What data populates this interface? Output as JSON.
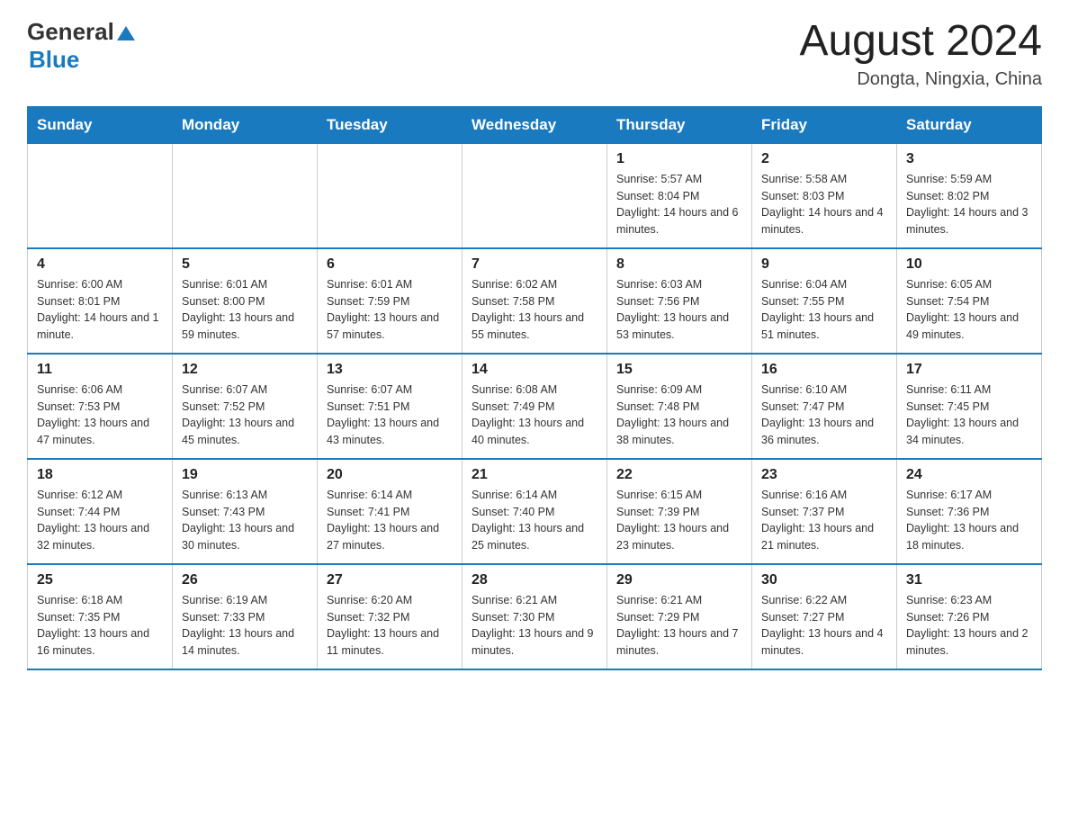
{
  "header": {
    "logo_general": "General",
    "logo_blue": "Blue",
    "title": "August 2024",
    "subtitle": "Dongta, Ningxia, China"
  },
  "weekdays": [
    "Sunday",
    "Monday",
    "Tuesday",
    "Wednesday",
    "Thursday",
    "Friday",
    "Saturday"
  ],
  "weeks": [
    [
      {
        "day": "",
        "info": ""
      },
      {
        "day": "",
        "info": ""
      },
      {
        "day": "",
        "info": ""
      },
      {
        "day": "",
        "info": ""
      },
      {
        "day": "1",
        "info": "Sunrise: 5:57 AM\nSunset: 8:04 PM\nDaylight: 14 hours and 6 minutes."
      },
      {
        "day": "2",
        "info": "Sunrise: 5:58 AM\nSunset: 8:03 PM\nDaylight: 14 hours and 4 minutes."
      },
      {
        "day": "3",
        "info": "Sunrise: 5:59 AM\nSunset: 8:02 PM\nDaylight: 14 hours and 3 minutes."
      }
    ],
    [
      {
        "day": "4",
        "info": "Sunrise: 6:00 AM\nSunset: 8:01 PM\nDaylight: 14 hours and 1 minute."
      },
      {
        "day": "5",
        "info": "Sunrise: 6:01 AM\nSunset: 8:00 PM\nDaylight: 13 hours and 59 minutes."
      },
      {
        "day": "6",
        "info": "Sunrise: 6:01 AM\nSunset: 7:59 PM\nDaylight: 13 hours and 57 minutes."
      },
      {
        "day": "7",
        "info": "Sunrise: 6:02 AM\nSunset: 7:58 PM\nDaylight: 13 hours and 55 minutes."
      },
      {
        "day": "8",
        "info": "Sunrise: 6:03 AM\nSunset: 7:56 PM\nDaylight: 13 hours and 53 minutes."
      },
      {
        "day": "9",
        "info": "Sunrise: 6:04 AM\nSunset: 7:55 PM\nDaylight: 13 hours and 51 minutes."
      },
      {
        "day": "10",
        "info": "Sunrise: 6:05 AM\nSunset: 7:54 PM\nDaylight: 13 hours and 49 minutes."
      }
    ],
    [
      {
        "day": "11",
        "info": "Sunrise: 6:06 AM\nSunset: 7:53 PM\nDaylight: 13 hours and 47 minutes."
      },
      {
        "day": "12",
        "info": "Sunrise: 6:07 AM\nSunset: 7:52 PM\nDaylight: 13 hours and 45 minutes."
      },
      {
        "day": "13",
        "info": "Sunrise: 6:07 AM\nSunset: 7:51 PM\nDaylight: 13 hours and 43 minutes."
      },
      {
        "day": "14",
        "info": "Sunrise: 6:08 AM\nSunset: 7:49 PM\nDaylight: 13 hours and 40 minutes."
      },
      {
        "day": "15",
        "info": "Sunrise: 6:09 AM\nSunset: 7:48 PM\nDaylight: 13 hours and 38 minutes."
      },
      {
        "day": "16",
        "info": "Sunrise: 6:10 AM\nSunset: 7:47 PM\nDaylight: 13 hours and 36 minutes."
      },
      {
        "day": "17",
        "info": "Sunrise: 6:11 AM\nSunset: 7:45 PM\nDaylight: 13 hours and 34 minutes."
      }
    ],
    [
      {
        "day": "18",
        "info": "Sunrise: 6:12 AM\nSunset: 7:44 PM\nDaylight: 13 hours and 32 minutes."
      },
      {
        "day": "19",
        "info": "Sunrise: 6:13 AM\nSunset: 7:43 PM\nDaylight: 13 hours and 30 minutes."
      },
      {
        "day": "20",
        "info": "Sunrise: 6:14 AM\nSunset: 7:41 PM\nDaylight: 13 hours and 27 minutes."
      },
      {
        "day": "21",
        "info": "Sunrise: 6:14 AM\nSunset: 7:40 PM\nDaylight: 13 hours and 25 minutes."
      },
      {
        "day": "22",
        "info": "Sunrise: 6:15 AM\nSunset: 7:39 PM\nDaylight: 13 hours and 23 minutes."
      },
      {
        "day": "23",
        "info": "Sunrise: 6:16 AM\nSunset: 7:37 PM\nDaylight: 13 hours and 21 minutes."
      },
      {
        "day": "24",
        "info": "Sunrise: 6:17 AM\nSunset: 7:36 PM\nDaylight: 13 hours and 18 minutes."
      }
    ],
    [
      {
        "day": "25",
        "info": "Sunrise: 6:18 AM\nSunset: 7:35 PM\nDaylight: 13 hours and 16 minutes."
      },
      {
        "day": "26",
        "info": "Sunrise: 6:19 AM\nSunset: 7:33 PM\nDaylight: 13 hours and 14 minutes."
      },
      {
        "day": "27",
        "info": "Sunrise: 6:20 AM\nSunset: 7:32 PM\nDaylight: 13 hours and 11 minutes."
      },
      {
        "day": "28",
        "info": "Sunrise: 6:21 AM\nSunset: 7:30 PM\nDaylight: 13 hours and 9 minutes."
      },
      {
        "day": "29",
        "info": "Sunrise: 6:21 AM\nSunset: 7:29 PM\nDaylight: 13 hours and 7 minutes."
      },
      {
        "day": "30",
        "info": "Sunrise: 6:22 AM\nSunset: 7:27 PM\nDaylight: 13 hours and 4 minutes."
      },
      {
        "day": "31",
        "info": "Sunrise: 6:23 AM\nSunset: 7:26 PM\nDaylight: 13 hours and 2 minutes."
      }
    ]
  ]
}
